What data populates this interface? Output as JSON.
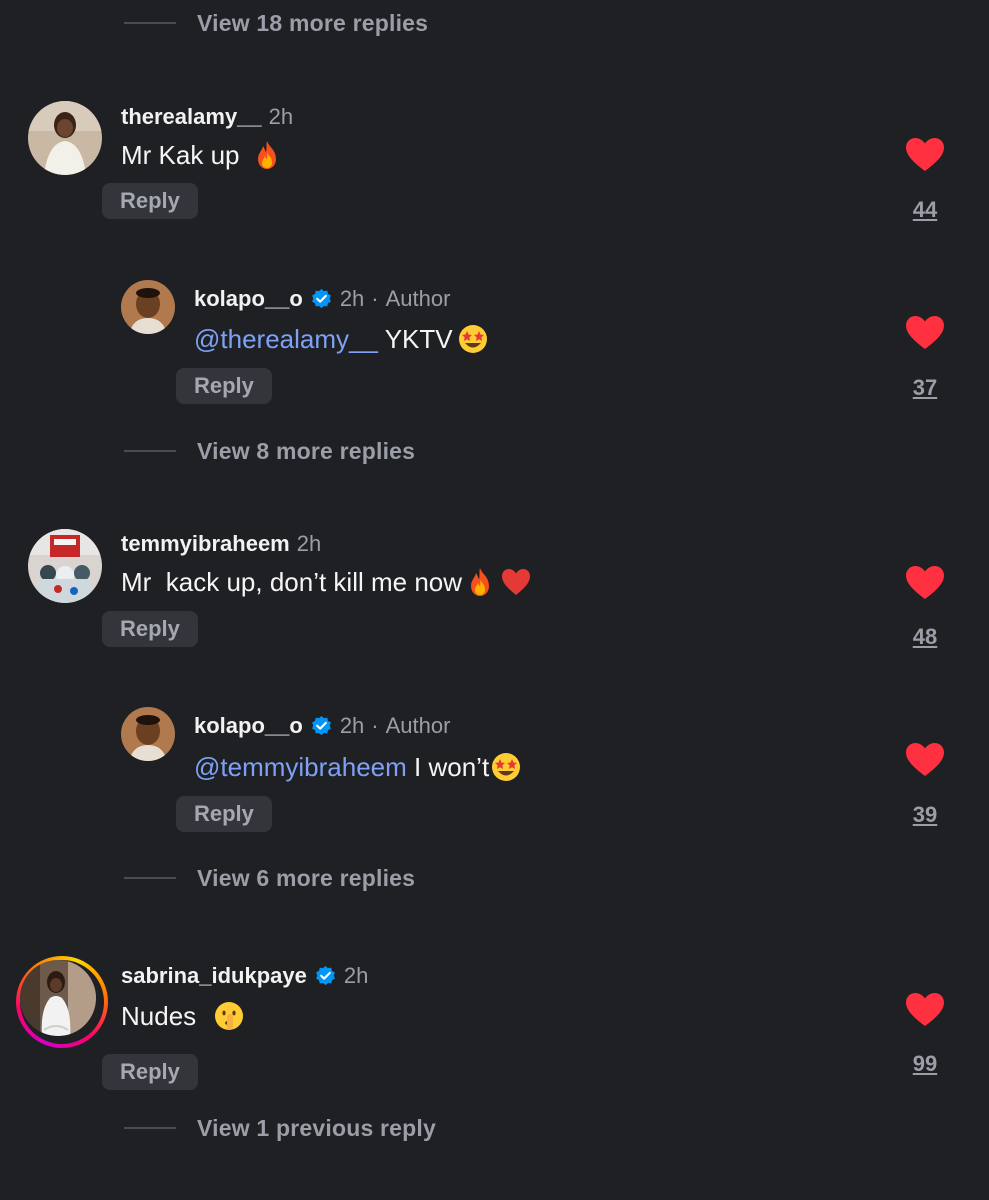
{
  "view_more": {
    "top": "View 18 more replies",
    "c1": "View 8 more replies",
    "c2": "View 6 more replies",
    "c3": "View 1 previous reply"
  },
  "comments": [
    {
      "username": "therealamy__",
      "time": "2h",
      "text": "Mr Kak up ",
      "emoji": "fire-emoji",
      "reply_label": "Reply",
      "likes": "44",
      "replies": [
        {
          "username": "kolapo__o",
          "verified": true,
          "time": "2h",
          "sep": "·",
          "badge": "Author",
          "mention": "@therealamy__",
          "text": " YKTV",
          "emoji": "star-struck-emoji",
          "reply_label": "Reply",
          "likes": "37"
        }
      ]
    },
    {
      "username": "temmyibraheem",
      "time": "2h",
      "text": "Mr  kack up, don’t kill me now",
      "emoji": "fire-emoji heart-emoji",
      "reply_label": "Reply",
      "likes": "48",
      "replies": [
        {
          "username": "kolapo__o",
          "verified": true,
          "time": "2h",
          "sep": "·",
          "badge": "Author",
          "mention": "@temmyibraheem",
          "text": " I won’t",
          "emoji": "star-struck-emoji",
          "reply_label": "Reply",
          "likes": "39"
        }
      ]
    },
    {
      "username": "sabrina_idukpaye",
      "verified": true,
      "time": "2h",
      "text": "Nudes ",
      "emoji": "shushing-face-emoji",
      "reply_label": "Reply",
      "likes": "99"
    }
  ],
  "colors": {
    "background": "#1f2024",
    "mention": "#7ea1f5",
    "like": "#ff3040",
    "verified": "#0095f6"
  }
}
